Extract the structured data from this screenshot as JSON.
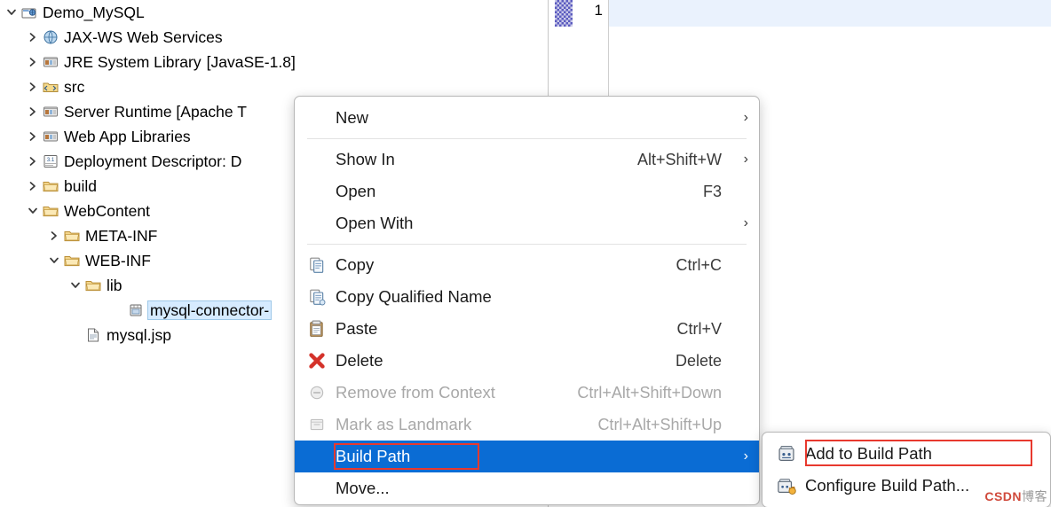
{
  "tree": {
    "items": [
      {
        "label": "Demo_MySQL",
        "icon": "project-icon",
        "twisty": "expanded",
        "indent": 6,
        "selected": false
      },
      {
        "label": "JAX-WS Web Services",
        "icon": "jaxws-icon",
        "twisty": "collapsed",
        "indent": 30,
        "selected": false
      },
      {
        "label": "JRE System Library",
        "bracket": "[JavaSE-1.8]",
        "icon": "library-icon",
        "twisty": "collapsed",
        "indent": 30,
        "selected": false
      },
      {
        "label": "src",
        "icon": "source-folder-icon",
        "twisty": "collapsed",
        "indent": 30,
        "selected": false
      },
      {
        "label": "Server Runtime [Apache T",
        "icon": "library-icon",
        "twisty": "collapsed",
        "indent": 30,
        "selected": false
      },
      {
        "label": "Web App Libraries",
        "icon": "library-icon",
        "twisty": "collapsed",
        "indent": 30,
        "selected": false
      },
      {
        "label": "Deployment Descriptor: D",
        "icon": "deployment-descriptor-icon",
        "twisty": "collapsed",
        "indent": 30,
        "selected": false
      },
      {
        "label": "build",
        "icon": "folder-icon",
        "twisty": "collapsed",
        "indent": 30,
        "selected": false
      },
      {
        "label": "WebContent",
        "icon": "folder-icon",
        "twisty": "expanded",
        "indent": 30,
        "selected": false
      },
      {
        "label": "META-INF",
        "icon": "folder-icon",
        "twisty": "collapsed",
        "indent": 54,
        "selected": false
      },
      {
        "label": "WEB-INF",
        "icon": "folder-icon",
        "twisty": "expanded",
        "indent": 54,
        "selected": false
      },
      {
        "label": "lib",
        "icon": "folder-icon",
        "twisty": "expanded",
        "indent": 78,
        "selected": false
      },
      {
        "label": "mysql-connector-",
        "icon": "jar-icon",
        "twisty": "none",
        "indent": 126,
        "selected": true
      },
      {
        "label": "mysql.jsp",
        "icon": "jsp-file-icon",
        "twisty": "none",
        "indent": 78,
        "selected": false
      }
    ]
  },
  "editor": {
    "line_number": "1"
  },
  "context_menu": {
    "items": [
      {
        "name": "new",
        "label": "New",
        "accel": "",
        "submenu": "›",
        "icon": "",
        "disabled": false,
        "highlight": false
      },
      {
        "name": "separator",
        "label": "",
        "type": "separator"
      },
      {
        "name": "show-in",
        "label": "Show In",
        "accel": "Alt+Shift+W",
        "submenu": "›",
        "icon": "",
        "disabled": false,
        "highlight": false
      },
      {
        "name": "open",
        "label": "Open",
        "accel": "F3",
        "submenu": "",
        "icon": "",
        "disabled": false,
        "highlight": false
      },
      {
        "name": "open-with",
        "label": "Open With",
        "accel": "",
        "submenu": "›",
        "icon": "",
        "disabled": false,
        "highlight": false
      },
      {
        "name": "separator",
        "label": "",
        "type": "separator"
      },
      {
        "name": "copy",
        "label": "Copy",
        "accel": "Ctrl+C",
        "submenu": "",
        "icon": "copy-icon",
        "disabled": false,
        "highlight": false
      },
      {
        "name": "copy-qualified-name",
        "label": "Copy Qualified Name",
        "accel": "",
        "submenu": "",
        "icon": "copy-qualified-icon",
        "disabled": false,
        "highlight": false
      },
      {
        "name": "paste",
        "label": "Paste",
        "accel": "Ctrl+V",
        "submenu": "",
        "icon": "paste-icon",
        "disabled": false,
        "highlight": false
      },
      {
        "name": "delete",
        "label": "Delete",
        "accel": "Delete",
        "submenu": "",
        "icon": "delete-icon",
        "disabled": false,
        "highlight": false
      },
      {
        "name": "remove-from-context",
        "label": "Remove from Context",
        "accel": "Ctrl+Alt+Shift+Down",
        "submenu": "",
        "icon": "remove-context-icon",
        "disabled": true,
        "highlight": false
      },
      {
        "name": "mark-as-landmark",
        "label": "Mark as Landmark",
        "accel": "Ctrl+Alt+Shift+Up",
        "submenu": "",
        "icon": "landmark-icon",
        "disabled": true,
        "highlight": false
      },
      {
        "name": "build-path",
        "label": "Build Path",
        "accel": "",
        "submenu": "›",
        "icon": "",
        "disabled": false,
        "highlight": true
      },
      {
        "name": "move",
        "label": "Move...",
        "accel": "",
        "submenu": "",
        "icon": "",
        "disabled": false,
        "highlight": false
      }
    ]
  },
  "submenu": {
    "items": [
      {
        "name": "add-to-build-path",
        "label": "Add to Build Path",
        "icon": "add-build-path-icon",
        "highlighted_box": true
      },
      {
        "name": "configure-build-path",
        "label": "Configure Build Path...",
        "icon": "configure-build-path-icon",
        "highlighted_box": false
      }
    ]
  },
  "watermark": {
    "prefix": "CSDN",
    "suffix": "博客"
  },
  "colors": {
    "selection_blue": "#0a6cd4",
    "tree_selection": "#d6ebff",
    "red_highlight": "#e8392e",
    "bracket_text": "#a07a3c",
    "active_line": "#eaf2fd"
  }
}
